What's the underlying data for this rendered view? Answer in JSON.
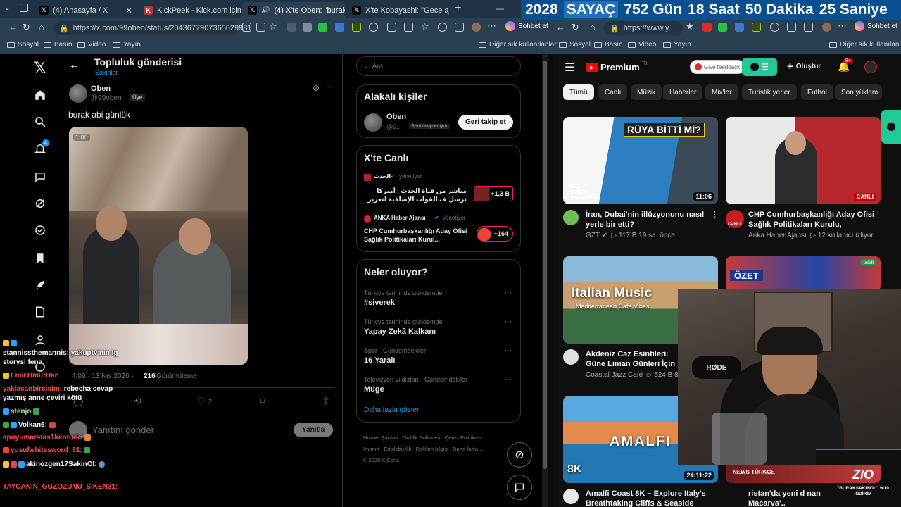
{
  "browser": {
    "tabs": [
      {
        "title": "(4) Anasayfa / X",
        "icon": "x-logo-icon"
      },
      {
        "title": "KickPeek - Kick.com için Gerçe",
        "icon": "kickpeek-icon"
      },
      {
        "title": "(4) X'te Oben: \"burak abi g",
        "icon": "x-logo-icon"
      },
      {
        "title": "X'te Kobayashi: \"Gece ajan old",
        "icon": "x-logo-icon"
      }
    ],
    "left_url": "https://x.com/99oben/status/2043677907365629981",
    "right_url": "https://www.y...",
    "copilot_label": "Sohbet et",
    "bookmarks": [
      "Sosyal",
      "Basın",
      "Video",
      "Yayın"
    ],
    "other_bookmarks": "Diğer sık kullanılanlar"
  },
  "counter": {
    "year": "2028",
    "label": "SAYAÇ",
    "days": "752 Gün",
    "hours": "18 Saat",
    "minutes": "50 Dakika",
    "seconds": "25 Saniye"
  },
  "x": {
    "header_title": "Topluluk gönderisi",
    "header_sub": "Sakinler",
    "author_name": "Oben",
    "author_handle": "@99oben",
    "member_badge": "Üye",
    "post_text": "burak abi günlük",
    "photo_badge": "1:00",
    "timestamp": "4:09 · 13 Nis 2026 ·",
    "views_count": "216",
    "views_label": "Görüntüleme",
    "likes": "2",
    "reply_placeholder": "Yanıtını gönder",
    "reply_button": "Yanıtla",
    "nav_badge": "4",
    "search_placeholder": "Ara",
    "related": {
      "title": "Alakalı kişiler",
      "name": "Oben",
      "handle": "@9...",
      "follows_you": "Seni takip ediyor",
      "follow_back": "Geri takip et"
    },
    "live": {
      "title": "X'te Canlı",
      "items": [
        {
          "source": "الحدث",
          "status": "yönetiyor",
          "text": "مباشر من قناة الحدث | أميركا ترسل ف القوات الإضافية لتعزيز الحصار",
          "count": "+1,3 B"
        },
        {
          "source": "ANKA Haber Ajansı",
          "status": "yönetiyor",
          "text": "CHP Cumhurbaşkanlığı Aday Ofisi Sağlık Politikaları Kurul...",
          "count": "+164"
        }
      ]
    },
    "trends": {
      "title": "Neler oluyor?",
      "items": [
        {
          "category": "Türkiye tarihinde gündemde",
          "name": "#siverek"
        },
        {
          "category": "Türkiye tarihinde gündemde",
          "name": "Yapay Zekâ Kalkanı"
        },
        {
          "category": "Spor · Gündemdekiler",
          "name": "16 Yaralı"
        },
        {
          "category": "Televizyon yıldızları · Gündemdekiler",
          "name": "Müge"
        }
      ],
      "show_more": "Daha fazla göster"
    },
    "footer_links": [
      "Hizmet Şartları",
      "Gizlilik Politikası",
      "Çerez Politikası",
      "Imprint",
      "Erişilebilirlik",
      "Reklam bilgisi",
      "Daha fazla ..."
    ],
    "copyright": "© 2026 X Corp."
  },
  "youtube": {
    "logo": "Premium",
    "logo_sup": "TR",
    "feedback": "Give feedback",
    "create": "Oluştur",
    "notif_count": "9+",
    "chips": [
      "Tümü",
      "Canlı",
      "Müzik",
      "Haberler",
      "Mix'ler",
      "Turistik yerler",
      "Futbol",
      "Son yüklen"
    ],
    "videos": [
      {
        "title": "İran, Dubai'nin illüzyonunu nasıl yerle bir etti?",
        "channel": "GZT",
        "meta": "117 B   19 sa. önce",
        "duration": "11:06",
        "thumb_text": "RÜYA BİTTİ Mİ?",
        "corner": "GZT · EDİTÖR ANLATIYOR"
      },
      {
        "title": "CHP Cumhurbaşkanlığı Aday Ofisi Sağlık Politikaları Kurulu, veteriner...",
        "channel": "Anka Haber Ajansı",
        "meta": "12 kullanıcı izliyor",
        "duration": "CANLI",
        "channel_badge": "CANLI"
      },
      {
        "title": "Akdeniz Caz Esintileri: Güne Liman Günleri İçin Rahatlatı",
        "channel": "Coastal Jazz Café",
        "meta": "524 B   8 a",
        "thumb_text": "Italian Music",
        "thumb_sub": "Mediterranean Cafe Vibes"
      },
      {
        "title": "ÖZET",
        "channel": "",
        "meta": "",
        "thumb_text": "ÖZET",
        "corner": "tabii"
      },
      {
        "title": "Amalfi Coast 8K – Explore Italy's Breathtaking Cliffs & Seaside",
        "channel": "",
        "meta": "",
        "duration": "24:11:22",
        "thumb_text": "AMALFI",
        "corner": "8K"
      },
      {
        "title": "ristan'da yeni d nan Macarva'..",
        "channel": "",
        "meta": "",
        "thumb_text": "NEWS TÜRKÇE"
      }
    ]
  },
  "chat": [
    {
      "user": "stannissthemannis:",
      "msg": "yakuptv'nin ig storysi fena",
      "user_color": "#ffffff"
    },
    {
      "user": "EmirTimurHan",
      "msg": "",
      "user_color": "#ff4b4b"
    },
    {
      "user": "yaklasanbircisim:",
      "msg": "rebecha cevap yazmış anne çeviri kötü",
      "user_color": "#ff4b4b"
    },
    {
      "user": "stenjo",
      "msg": "",
      "user_color": "#a6e3a1"
    },
    {
      "user": "Volkan6:",
      "msg": "",
      "user_color": "#ffffff"
    },
    {
      "user": "apoyumarstas1kenturk:",
      "msg": "",
      "user_color": "#ff4b4b"
    },
    {
      "user": "yusufwhitesword_31:",
      "msg": "",
      "user_color": "#ff4b4b"
    },
    {
      "user": "akinozgen17SakinOl:",
      "msg": "",
      "user_color": "#ffffff"
    },
    {
      "user": "TAYCANIN_GGZOZUNU_SIKEN31:",
      "msg": "",
      "user_color": "#ff4b4b"
    }
  ],
  "overlay": {
    "brand": "ZIO",
    "promo": "\"BURAKSAKINOL\" %10 İNDİRİM",
    "mic_brand": "RØDE"
  },
  "colors": {
    "accent_x": "#1d9bf0",
    "yt_red": "#ff0000",
    "counter_bg": "#0a4f8f"
  }
}
